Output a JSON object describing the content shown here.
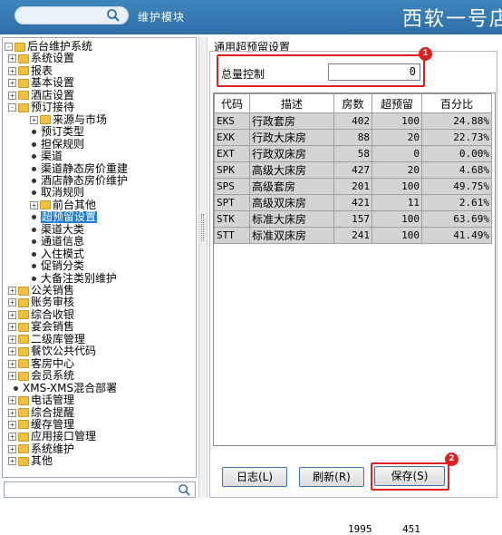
{
  "header": {
    "module_label": "维护模块",
    "brand": "西软一号店"
  },
  "tree": [
    {
      "label": "后台维护系统",
      "kind": "root",
      "expander": "-"
    },
    {
      "label": "系统设置",
      "kind": "folder",
      "expander": "+"
    },
    {
      "label": "报表",
      "kind": "folder",
      "expander": "+"
    },
    {
      "label": "基本设置",
      "kind": "folder",
      "expander": "+"
    },
    {
      "label": "酒店设置",
      "kind": "folder",
      "expander": "+"
    },
    {
      "label": "预订接待",
      "kind": "folder",
      "expander": "-"
    },
    {
      "label": "来源与市场",
      "kind": "folder",
      "expander": "+"
    },
    {
      "label": "预订类型",
      "kind": "leaf"
    },
    {
      "label": "担保规则",
      "kind": "leaf"
    },
    {
      "label": "渠道",
      "kind": "leaf"
    },
    {
      "label": "渠道静态房价重建",
      "kind": "leaf"
    },
    {
      "label": "酒店静态房价维护",
      "kind": "leaf"
    },
    {
      "label": "取消规则",
      "kind": "leaf"
    },
    {
      "label": "前台其他",
      "kind": "folder",
      "expander": "+"
    },
    {
      "label": "超预留设置",
      "kind": "leaf",
      "selected": true
    },
    {
      "label": "渠道大类",
      "kind": "leaf"
    },
    {
      "label": "通道信息",
      "kind": "leaf"
    },
    {
      "label": "入住模式",
      "kind": "leaf"
    },
    {
      "label": "促销分类",
      "kind": "leaf"
    },
    {
      "label": "大备注类别维护",
      "kind": "leaf"
    },
    {
      "label": "公关销售",
      "kind": "folder",
      "expander": "+"
    },
    {
      "label": "账务审核",
      "kind": "folder",
      "expander": "+"
    },
    {
      "label": "综合收银",
      "kind": "folder",
      "expander": "+"
    },
    {
      "label": "宴会销售",
      "kind": "folder",
      "expander": "+"
    },
    {
      "label": "二级库管理",
      "kind": "folder",
      "expander": "+"
    },
    {
      "label": "餐饮公共代码",
      "kind": "folder",
      "expander": "+"
    },
    {
      "label": "客房中心",
      "kind": "folder",
      "expander": "+"
    },
    {
      "label": "会员系统",
      "kind": "folder",
      "expander": "+"
    },
    {
      "label": "XMS-XMS混合部署",
      "kind": "leaf"
    },
    {
      "label": "电话管理",
      "kind": "folder",
      "expander": "+"
    },
    {
      "label": "综合提醒",
      "kind": "folder",
      "expander": "+"
    },
    {
      "label": "缓存管理",
      "kind": "folder",
      "expander": "+"
    },
    {
      "label": "应用接口管理",
      "kind": "folder",
      "expander": "+"
    },
    {
      "label": "系统维护",
      "kind": "folder",
      "expander": "+"
    },
    {
      "label": "其他",
      "kind": "folder",
      "expander": "+"
    }
  ],
  "main": {
    "section_title": "通用超预留设置",
    "total_label": "总量控制",
    "total_value": "0",
    "badge1": "1",
    "badge2": "2"
  },
  "grid": {
    "headers": [
      "代码",
      "描述",
      "房数",
      "超预留",
      "百分比"
    ],
    "rows": [
      {
        "code": "EKS",
        "desc": "行政套房",
        "rooms": "402",
        "over": "100",
        "pct": "24.88%"
      },
      {
        "code": "EXK",
        "desc": "行政大床房",
        "rooms": "88",
        "over": "20",
        "pct": "22.73%"
      },
      {
        "code": "EXT",
        "desc": "行政双床房",
        "rooms": "58",
        "over": "0",
        "pct": "0.00%",
        "green": true
      },
      {
        "code": "SPK",
        "desc": "高级大床房",
        "rooms": "427",
        "over": "20",
        "pct": "4.68%"
      },
      {
        "code": "SPS",
        "desc": "高级套房",
        "rooms": "201",
        "over": "100",
        "pct": "49.75%"
      },
      {
        "code": "SPT",
        "desc": "高级双床房",
        "rooms": "421",
        "over": "11",
        "pct": "2.61%"
      },
      {
        "code": "STK",
        "desc": "标准大床房",
        "rooms": "157",
        "over": "100",
        "pct": "63.69%"
      },
      {
        "code": "STT",
        "desc": "标准双床房",
        "rooms": "241",
        "over": "100",
        "pct": "41.49%"
      }
    ],
    "total_rooms": "1995",
    "total_over": "451"
  },
  "buttons": {
    "log": "日志(L)",
    "refresh": "刷新(R)",
    "save": "保存(S)"
  }
}
